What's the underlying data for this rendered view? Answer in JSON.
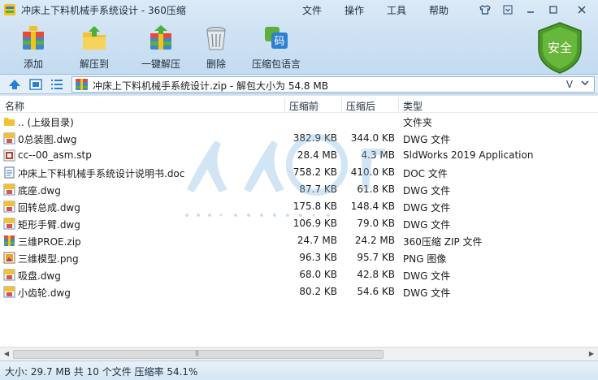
{
  "window": {
    "title": "冲床上下料机械手系统设计 - 360压缩",
    "menu": [
      "文件",
      "操作",
      "工具",
      "帮助"
    ]
  },
  "toolbar": {
    "items": [
      {
        "label": "添加",
        "icon": "add-archive-icon"
      },
      {
        "label": "解压到",
        "icon": "extract-to-icon"
      },
      {
        "label": "一键解压",
        "icon": "one-click-extract-icon"
      },
      {
        "label": "删除",
        "icon": "delete-icon"
      },
      {
        "label": "压缩包语言",
        "icon": "archive-language-icon"
      }
    ],
    "icon_text": "码",
    "security_label": "安全"
  },
  "address": {
    "path": "冲床上下料机械手系统设计.zip - 解包大小为 54.8 MB"
  },
  "columns": {
    "name": "名称",
    "compressed": "压缩前",
    "uncompressed": "压缩后",
    "type": "类型"
  },
  "files": [
    {
      "name": ".. (上级目录)",
      "compressed": "",
      "uncompressed": "",
      "type": "文件夹",
      "icon": "folder-icon"
    },
    {
      "name": "0总装图.dwg",
      "compressed": "382.9 KB",
      "uncompressed": "344.0 KB",
      "type": "DWG 文件",
      "icon": "dwg-file-icon"
    },
    {
      "name": "cc--00_asm.stp",
      "compressed": "28.4 MB",
      "uncompressed": "4.3 MB",
      "type": "SldWorks 2019 Application",
      "icon": "stp-file-icon"
    },
    {
      "name": "冲床上下料机械手系统设计说明书.doc",
      "compressed": "758.2 KB",
      "uncompressed": "410.0 KB",
      "type": "DOC 文件",
      "icon": "doc-file-icon"
    },
    {
      "name": "底座.dwg",
      "compressed": "87.7 KB",
      "uncompressed": "61.8 KB",
      "type": "DWG 文件",
      "icon": "dwg-file-icon"
    },
    {
      "name": "回转总成.dwg",
      "compressed": "175.8 KB",
      "uncompressed": "148.4 KB",
      "type": "DWG 文件",
      "icon": "dwg-file-icon"
    },
    {
      "name": "矩形手臂.dwg",
      "compressed": "106.9 KB",
      "uncompressed": "79.0 KB",
      "type": "DWG 文件",
      "icon": "dwg-file-icon"
    },
    {
      "name": "三维PROE.zip",
      "compressed": "24.7 MB",
      "uncompressed": "24.2 MB",
      "type": "360压缩 ZIP 文件",
      "icon": "zip-file-icon"
    },
    {
      "name": "三维模型.png",
      "compressed": "96.3 KB",
      "uncompressed": "95.7 KB",
      "type": "PNG 图像",
      "icon": "png-file-icon"
    },
    {
      "name": "吸盘.dwg",
      "compressed": "68.0 KB",
      "uncompressed": "42.8 KB",
      "type": "DWG 文件",
      "icon": "dwg-file-icon"
    },
    {
      "name": "小齿轮.dwg",
      "compressed": "80.2 KB",
      "uncompressed": "54.6 KB",
      "type": "DWG 文件",
      "icon": "dwg-file-icon"
    }
  ],
  "status": {
    "text": "大小: 29.7 MB 共 10 个文件 压缩率 54.1%"
  }
}
